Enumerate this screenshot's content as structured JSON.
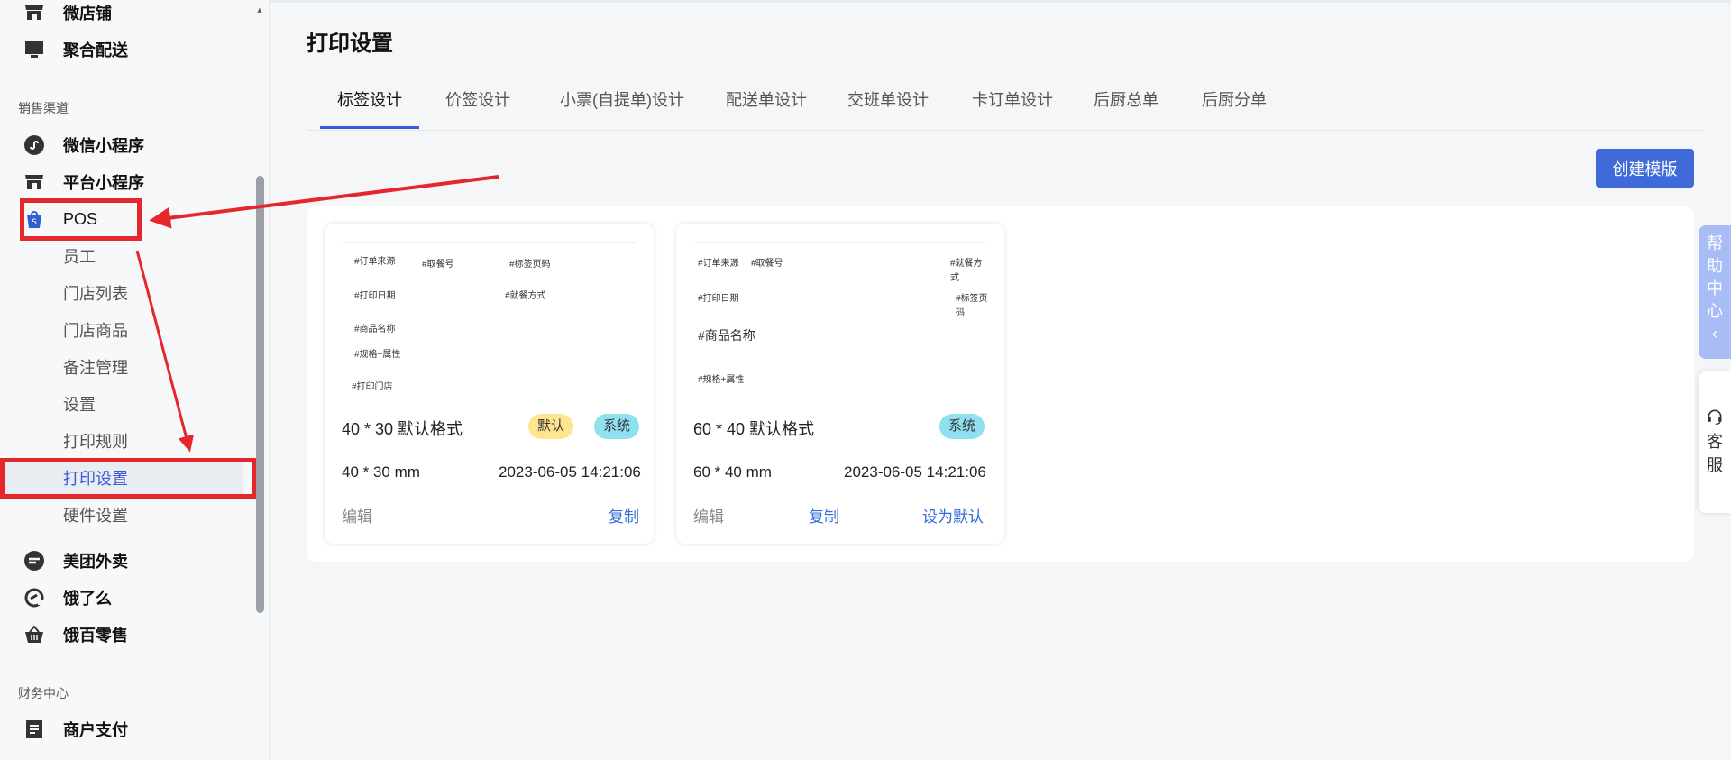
{
  "sidebar": {
    "items_top": [
      {
        "label": "微店铺",
        "icon": "store-icon"
      },
      {
        "label": "聚合配送",
        "icon": "monitor-icon"
      }
    ],
    "section_sales": "销售渠道",
    "sales_items": [
      {
        "label": "微信小程序",
        "icon": "mini-program-icon"
      },
      {
        "label": "平台小程序",
        "icon": "store-icon"
      },
      {
        "label": "POS",
        "icon": "shopping-bag-icon"
      }
    ],
    "pos_sub": [
      "员工",
      "门店列表",
      "门店商品",
      "备注管理",
      "设置",
      "打印规则",
      "打印设置",
      "硬件设置"
    ],
    "more_items": [
      {
        "label": "美团外卖",
        "icon": "meituan-icon"
      },
      {
        "label": "饿了么",
        "icon": "eleme-icon"
      },
      {
        "label": "饿百零售",
        "icon": "basket-icon"
      }
    ],
    "section_finance": "财务中心",
    "finance_items": [
      {
        "label": "商户支付",
        "icon": "document-icon"
      }
    ]
  },
  "page": {
    "title": "打印设置",
    "tabs": [
      "标签设计",
      "价签设计",
      "小票(自提单)设计",
      "配送单设计",
      "交班单设计",
      "卡订单设计",
      "后厨总单",
      "后厨分单"
    ],
    "create_button": "创建模版"
  },
  "cards": [
    {
      "preview_fields": [
        "#订单来源",
        "#取餐号",
        "#标签页码",
        "#打印日期",
        "#就餐方式",
        "#商品名称",
        "#规格+属性",
        "#打印门店"
      ],
      "name": "40 * 30 默认格式",
      "badge_default": "默认",
      "badge_system": "系统",
      "size": "40 * 30 mm",
      "time": "2023-06-05 14:21:06",
      "edit": "编辑",
      "copy": "复制"
    },
    {
      "preview_fields": [
        "#订单来源",
        "#取餐号",
        "#就餐方",
        "式",
        "#打印日期",
        "#标签页",
        "码",
        "#商品名称",
        "#规格+属性"
      ],
      "name": "60 * 40 默认格式",
      "badge_system": "系统",
      "size": "60 * 40 mm",
      "time": "2023-06-05 14:21:06",
      "edit": "编辑",
      "copy": "复制",
      "set_default": "设为默认"
    }
  ],
  "floating": {
    "help_chars": [
      "帮",
      "助",
      "中",
      "心",
      "‹"
    ],
    "service_chars": [
      "客",
      "服"
    ]
  },
  "colors": {
    "accent": "#3f6ad8",
    "highlight": "#e5262c"
  }
}
